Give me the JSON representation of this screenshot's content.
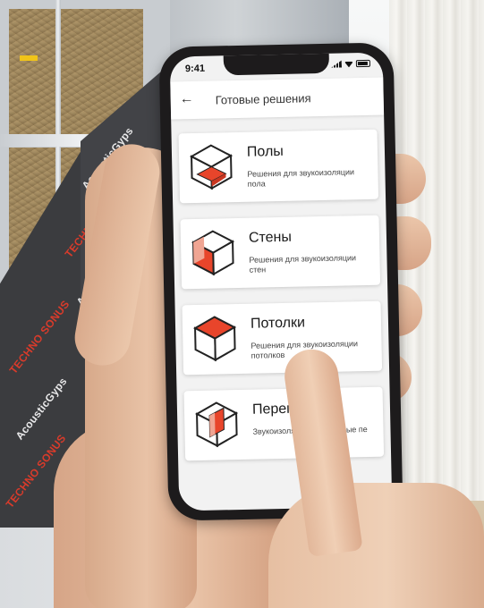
{
  "status": {
    "time": "9:41"
  },
  "appbar": {
    "title": "Готовые решения"
  },
  "cards": [
    {
      "title": "Полы",
      "subtitle": "Решения для звукоизоляции пола"
    },
    {
      "title": "Стены",
      "subtitle": "Решения для звукоизоляции стен"
    },
    {
      "title": "Потолки",
      "subtitle": "Решения для звукоизоляции потолков"
    },
    {
      "title": "Перегор",
      "subtitle": "Звукоизоляцис возводимые пе"
    }
  ],
  "background": {
    "brand_1": "TECHNO SONUS",
    "brand_2": "AcousticGyps"
  },
  "colors": {
    "accent": "#e8452b",
    "accent_light": "#f0a593",
    "outline": "#222222"
  }
}
